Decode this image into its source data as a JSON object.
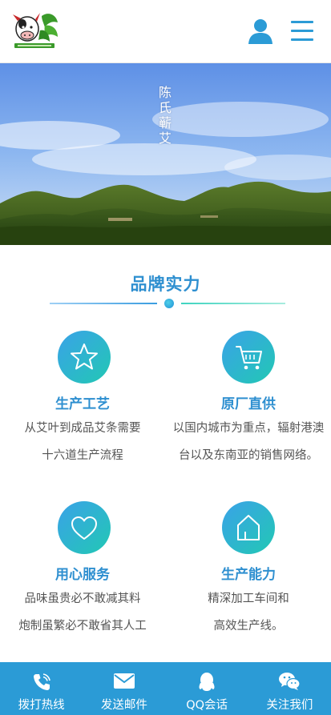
{
  "header": {
    "logo_icon": "cow-leaf-logo",
    "user_icon": "user-icon",
    "menu_icon": "menu-icon"
  },
  "banner": {
    "title": "陈氏蕲艾"
  },
  "section": {
    "title": "品牌实力"
  },
  "features": [
    {
      "icon": "star-icon",
      "title": "生产工艺",
      "desc_line1": "从艾叶到成品艾条需要",
      "desc_line2": "十六道生产流程"
    },
    {
      "icon": "cart-icon",
      "title": "原厂直供",
      "desc_line1": "以国内城市为重点，辐射港澳",
      "desc_line2": "台以及东南亚的销售网络。"
    },
    {
      "icon": "heart-icon",
      "title": "用心服务",
      "desc_line1": "品味虽贵必不敢减其料",
      "desc_line2": "炮制虽繁必不敢省其人工"
    },
    {
      "icon": "house-icon",
      "title": "生产能力",
      "desc_line1": "精深加工车间和",
      "desc_line2": "高效生产线。"
    }
  ],
  "bottom_bar": {
    "items": [
      {
        "icon": "phone-icon",
        "label": "拨打热线"
      },
      {
        "icon": "mail-icon",
        "label": "发送邮件"
      },
      {
        "icon": "qq-icon",
        "label": "QQ会话"
      },
      {
        "icon": "wechat-icon",
        "label": "关注我们"
      }
    ]
  },
  "colors": {
    "brand_blue": "#2e8fd0",
    "bar_blue": "#2b9bd6",
    "gradient_start": "#3aa2e8",
    "gradient_end": "#22c8b4"
  }
}
